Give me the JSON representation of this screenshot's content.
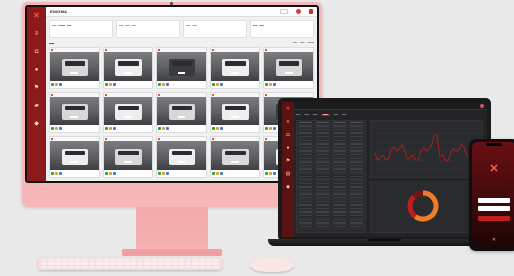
{
  "imac_app": {
    "brand": "ENIGMA",
    "nav": [
      {
        "icon": "x-logo-icon",
        "glyph": "✕"
      },
      {
        "icon": "list-icon",
        "glyph": "≡"
      },
      {
        "icon": "car-icon",
        "glyph": "◘"
      },
      {
        "icon": "user-icon",
        "glyph": "●"
      },
      {
        "icon": "flag-icon",
        "glyph": "⚑"
      },
      {
        "icon": "folder-icon",
        "glyph": "▰"
      },
      {
        "icon": "tag-icon",
        "glyph": "◆"
      }
    ],
    "camera_cards": [
      {
        "car": "gray"
      },
      {
        "car": "white"
      },
      {
        "car": "dark"
      },
      {
        "car": "white"
      },
      {
        "car": "gray"
      },
      {
        "car": "gray"
      },
      {
        "car": "white"
      },
      {
        "car": "gray"
      },
      {
        "car": "white"
      },
      {
        "car": "dark"
      },
      {
        "car": "white"
      },
      {
        "car": "gray"
      },
      {
        "car": "white"
      },
      {
        "car": "gray"
      },
      {
        "car": "white"
      }
    ]
  },
  "colors": {
    "imac_body": "#f6b7b9",
    "brand_red": "#8c1a1a",
    "accent_red": "#c01e1e",
    "laptop_body": "#1a1a1b",
    "donut_orange": "#f07c2a",
    "donut_red": "#c01e1e"
  }
}
